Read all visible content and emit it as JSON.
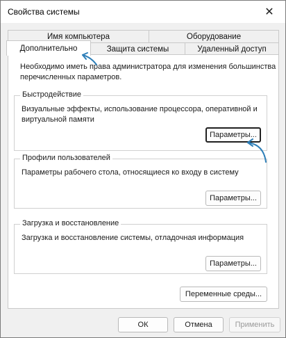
{
  "window": {
    "title": "Свойства системы",
    "close_symbol": "✕"
  },
  "tabs": {
    "row1": [
      "Имя компьютера",
      "Оборудование"
    ],
    "row2": [
      "Дополнительно",
      "Защита системы",
      "Удаленный доступ"
    ],
    "active": "Дополнительно"
  },
  "content": {
    "admin_note_line1": "Необходимо иметь права администратора для изменения большинства",
    "admin_note_line2": "перечисленных параметров.",
    "performance": {
      "title": "Быстродействие",
      "desc_line1": "Визуальные эффекты, использование процессора, оперативной и",
      "desc_line2": "виртуальной памяти",
      "button": "Параметры..."
    },
    "profiles": {
      "title": "Профили пользователей",
      "desc": "Параметры рабочего стола, относящиеся ко входу в систему",
      "button": "Параметры..."
    },
    "startup": {
      "title": "Загрузка и восстановление",
      "desc": "Загрузка и восстановление системы, отладочная информация",
      "button": "Параметры..."
    },
    "env_button": "Переменные среды..."
  },
  "footer": {
    "ok": "ОК",
    "cancel": "Отмена",
    "apply": "Применить"
  },
  "colors": {
    "annotation_arrow": "#2e7fb8"
  },
  "icons": [
    "close-icon",
    "pointer-arrow-icon"
  ]
}
